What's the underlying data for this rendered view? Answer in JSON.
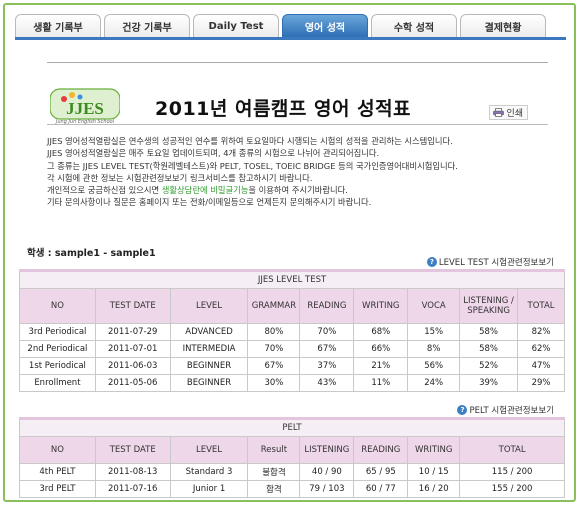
{
  "tabs": [
    "생활 기록부",
    "건강 기록부",
    "Daily Test",
    "영어 성적",
    "수학 성적",
    "결제현황"
  ],
  "active_tab": 3,
  "logo": {
    "text": "JJES",
    "school_name": "Jung Jun English School"
  },
  "title": "2011년 여름캠프 영어 성적표",
  "print_label": "인쇄",
  "description": {
    "line1": "JJES 영어성적열람실은 연수생의 성공적인 연수를 위하여 토요일마다 시행되는 시험의 성적을 관리하는 시스템입니다.",
    "line2": "JJES 영어성적열람실은 매주 토요일 업데이트되며, 4개 종류의 시험으로 나뉘어 관리되어집니다.",
    "line3": "그 종류는 JJES LEVEL TEST(학원레벨테스트)와 PELT, TOSEL, TOEIC BRIDGE 등의 국가인증영어대비시험입니다.",
    "line4": "각 시험에 관한 정보는 시험관련정보보기 링크서비스를 참고하시기 바랍니다.",
    "line5_a": "개인적으로 궁금하신점 있으시면 ",
    "line5_hl": "생활상담란에 비밀글기능",
    "line5_b": "을 이용하여 주시기바랍니다.",
    "line6": "기타 문의사항이나 질문은 홈페이지 또는 전화/이메일등으로 언제든지 문의해주시기 바랍니다."
  },
  "student_label": "학생 : sample1  -  sample1",
  "level_info_link": "LEVEL TEST 시험관련정보보기",
  "pelt_info_link": "PELT 시험관련정보보기",
  "level_table": {
    "caption": "JJES LEVEL TEST",
    "headers": [
      "NO",
      "TEST DATE",
      "LEVEL",
      "GRAMMAR",
      "READING",
      "WRITING",
      "VOCA",
      "LISTENING / SPEAKING",
      "TOTAL"
    ],
    "rows": [
      [
        "3rd Periodical",
        "2011-07-29",
        "ADVANCED",
        "80%",
        "70%",
        "68%",
        "15%",
        "58%",
        "82%"
      ],
      [
        "2nd Periodical",
        "2011-07-01",
        "INTERMEDIA",
        "70%",
        "67%",
        "66%",
        "8%",
        "58%",
        "62%"
      ],
      [
        "1st Periodical",
        "2011-06-03",
        "BEGINNER",
        "67%",
        "37%",
        "21%",
        "56%",
        "52%",
        "47%"
      ],
      [
        "Enrollment",
        "2011-05-06",
        "BEGINNER",
        "30%",
        "43%",
        "11%",
        "24%",
        "39%",
        "29%"
      ]
    ]
  },
  "pelt_table": {
    "caption": "PELT",
    "headers": [
      "NO",
      "TEST DATE",
      "LEVEL",
      "Result",
      "LISTENING",
      "READING",
      "WRITING",
      "TOTAL"
    ],
    "rows": [
      [
        "4th PELT",
        "2011-08-13",
        "Standard 3",
        "불합격",
        "40 / 90",
        "65 / 95",
        "10 / 15",
        "115 / 200"
      ],
      [
        "3rd PELT",
        "2011-07-16",
        "Junior 1",
        "합격",
        "79 / 103",
        "60 / 77",
        "16 / 20",
        "155 / 200"
      ]
    ]
  },
  "colors": {
    "accent_tab": "#2e6fb5",
    "frame": "#8bbf5a",
    "table_header": "#efd7ea",
    "highlight_text": "#2e9a2e"
  }
}
